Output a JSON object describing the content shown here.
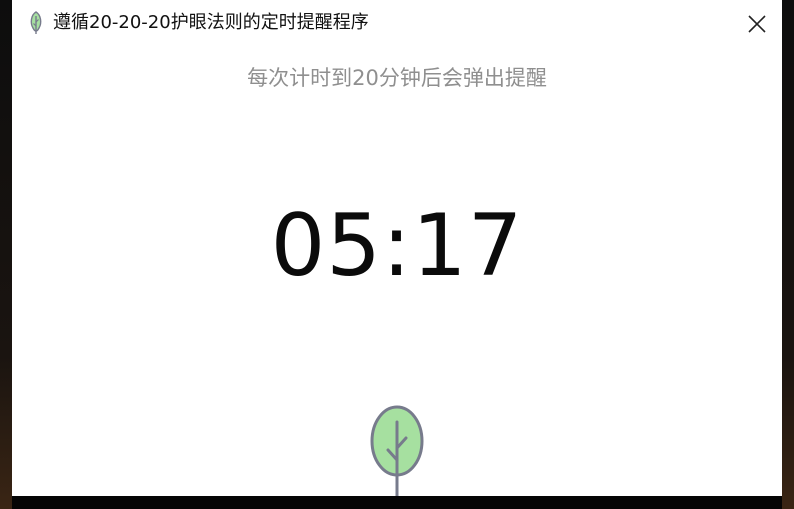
{
  "window": {
    "title": "遵循20-20-20护眼法则的定时提醒程序",
    "app_icon": "leaf-icon",
    "close_icon": "close-icon"
  },
  "main": {
    "subtitle": "每次计时到20分钟后会弹出提醒",
    "timer": "05:17",
    "illustration": "tree-icon"
  },
  "colors": {
    "window_bg": "#ffffff",
    "subtitle": "#8f8f8f",
    "timer": "#0b0b0b",
    "leaf_fill": "#a6e0a0",
    "leaf_stroke": "#777b8c"
  }
}
